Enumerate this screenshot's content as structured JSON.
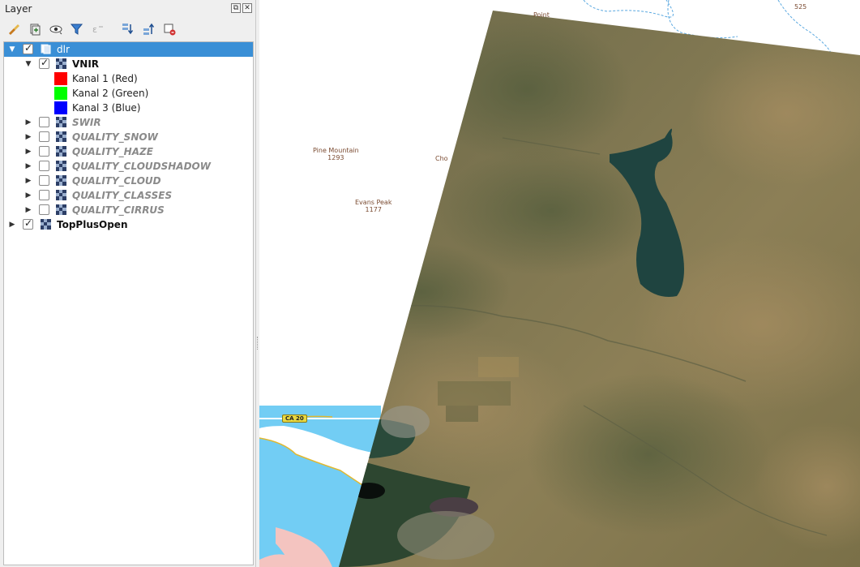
{
  "panel": {
    "title": "Layer",
    "float_btn": "⧉",
    "close_btn": "✕"
  },
  "toolbar": {
    "icons": [
      "style-manager-icon",
      "add-group-icon",
      "visibility-icon",
      "filter-icon",
      "filter-expression-icon",
      "expand-all-icon",
      "collapse-all-icon",
      "remove-layer-icon"
    ]
  },
  "tree": {
    "group": {
      "label": "dlr",
      "checked": true,
      "expanded": true
    },
    "vnir": {
      "label": "VNIR",
      "checked": true,
      "expanded": true
    },
    "bands": [
      {
        "label": "Kanal 1 (Red)",
        "color": "#ff0000"
      },
      {
        "label": "Kanal 2 (Green)",
        "color": "#00ff00"
      },
      {
        "label": "Kanal 3 (Blue)",
        "color": "#0000ff"
      }
    ],
    "sublayers": [
      {
        "label": "SWIR",
        "checked": false
      },
      {
        "label": "QUALITY_SNOW",
        "checked": false
      },
      {
        "label": "QUALITY_HAZE",
        "checked": false
      },
      {
        "label": "QUALITY_CLOUDSHADOW",
        "checked": false
      },
      {
        "label": "QUALITY_CLOUD",
        "checked": false
      },
      {
        "label": "QUALITY_CLASSES",
        "checked": false
      },
      {
        "label": "QUALITY_CIRRUS",
        "checked": false
      }
    ],
    "base": {
      "label": "TopPlusOpen",
      "checked": true
    }
  },
  "map": {
    "labels": [
      {
        "name": "Pine Mountain",
        "elev": "1293"
      },
      {
        "name": "Evans Peak",
        "elev": "1177"
      },
      {
        "name": "",
        "elev": "525"
      },
      {
        "name": "Point",
        "elev": ""
      },
      {
        "name": "Cho",
        "elev": ""
      }
    ],
    "road": "CA 20",
    "colors": {
      "water": "#72cdf4",
      "lake_dark": "#1f4440",
      "terrain": "#7a7250"
    }
  }
}
